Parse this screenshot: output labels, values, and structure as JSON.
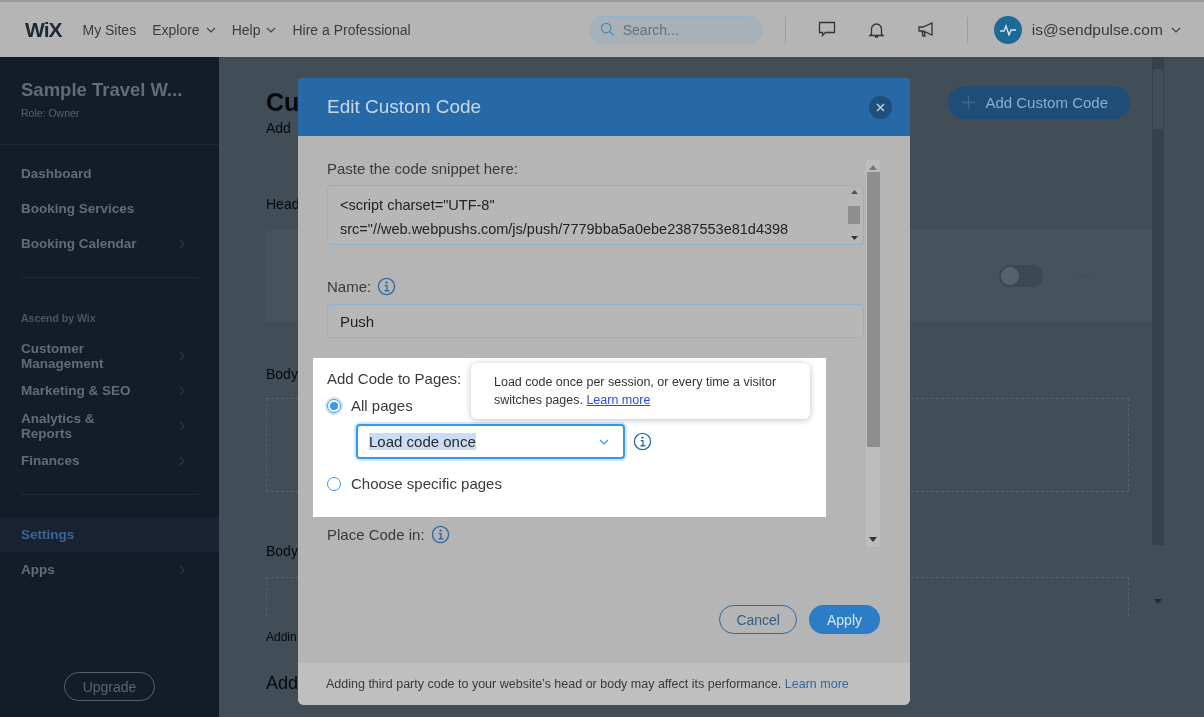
{
  "top_bar": {
    "logo": "WiX",
    "nav": [
      {
        "label": "My Sites",
        "has_menu": false
      },
      {
        "label": "Explore",
        "has_menu": true
      },
      {
        "label": "Help",
        "has_menu": true
      },
      {
        "label": "Hire a Professional",
        "has_menu": false
      }
    ],
    "search": {
      "placeholder": "Search..."
    },
    "account": {
      "email": "is@sendpulse.com"
    }
  },
  "sidebar": {
    "site_name": "Sample Travel W...",
    "role": "Role: Owner",
    "items": [
      {
        "kind": "divider"
      },
      {
        "kind": "item",
        "label": "Dashboard",
        "has_submenu": false,
        "selected": false
      },
      {
        "kind": "item",
        "label": "Booking Services",
        "has_submenu": false,
        "selected": false
      },
      {
        "kind": "item",
        "label": "Booking Calendar",
        "has_submenu": true,
        "selected": false
      },
      {
        "kind": "divider"
      },
      {
        "kind": "heading",
        "label": "Ascend by Wix"
      },
      {
        "kind": "item",
        "label": "Customer Management",
        "has_submenu": true,
        "selected": false
      },
      {
        "kind": "item",
        "label": "Marketing & SEO",
        "has_submenu": true,
        "selected": false
      },
      {
        "kind": "item",
        "label": "Analytics & Reports",
        "has_submenu": true,
        "selected": false
      },
      {
        "kind": "item",
        "label": "Finances",
        "has_submenu": true,
        "selected": false
      },
      {
        "kind": "divider"
      },
      {
        "kind": "item",
        "label": "Settings",
        "has_submenu": false,
        "selected": true
      },
      {
        "kind": "item",
        "label": "Apps",
        "has_submenu": true,
        "selected": false
      }
    ],
    "upgrade_button": "Upgrade"
  },
  "page": {
    "title": "Cu",
    "subtitle": "Add",
    "add_button": "Add Custom Code",
    "head_label": "Head",
    "head_toggle": {
      "on": false
    },
    "body_label_1": "Body",
    "body_label_2": "Body",
    "note": "Addin",
    "section_title": "Add"
  },
  "dialog": {
    "title": "Edit Custom Code",
    "snippet_label": "Paste the code snippet here:",
    "snippet_lines": [
      "<script charset=\"UTF-8\"",
      "src=\"//web.webpushs.com/js/push/7779bba5a0ebe2387553e81d4398"
    ],
    "name_label": "Name:",
    "name_value": "Push",
    "pages_label": "Add Code to Pages:",
    "page_options": [
      {
        "label": "All pages",
        "selected": true
      },
      {
        "label": "Choose specific pages",
        "selected": false
      }
    ],
    "load_select": {
      "value": "Load code once"
    },
    "tooltip": {
      "text": "Load code once per session, or every time a visitor switches pages.",
      "link": "Learn more"
    },
    "place_label": "Place Code in:",
    "buttons": [
      {
        "label": "Cancel",
        "kind": "secondary"
      },
      {
        "label": "Apply",
        "kind": "primary"
      }
    ],
    "footer": {
      "text": "Adding third party code to your website’s head or body may affect its performance.",
      "link": "Learn more"
    }
  }
}
